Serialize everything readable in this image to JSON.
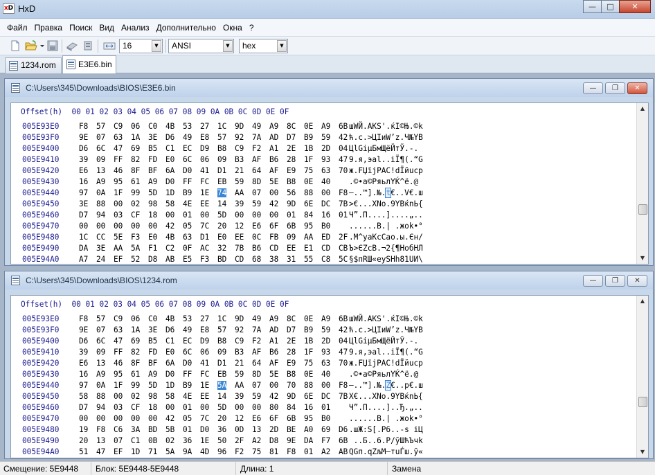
{
  "app": {
    "title": "HxD",
    "icon_label": "xD"
  },
  "menu": [
    "Файл",
    "Правка",
    "Поиск",
    "Вид",
    "Анализ",
    "Дополнительно",
    "Окна",
    "?"
  ],
  "toolbar": {
    "bytes_per_row": "16",
    "charset": "ANSI",
    "offset_base": "hex"
  },
  "tabs": [
    {
      "label": "1234.rom",
      "active": false
    },
    {
      "label": "E3E6.bin",
      "active": true
    }
  ],
  "header_row": "Offset(h)  00 01 02 03 04 05 06 07 08 09 0A 0B 0C 0D 0E 0F",
  "windows": [
    {
      "path": "C:\\Users\\345\\Downloads\\BIOS\\E3E6.bin",
      "selected_row": 6,
      "selected_col": 10,
      "rows": [
        {
          "offset": "005E93E0",
          "bytes": [
            "F8",
            "57",
            "C9",
            "06",
            "C0",
            "4B",
            "53",
            "27",
            "1C",
            "9D",
            "49",
            "A9",
            "8C",
            "0E",
            "A9",
            "6B"
          ],
          "text": "шWЙ.AKS'.ќI©Њ.©k"
        },
        {
          "offset": "005E93F0",
          "bytes": [
            "9E",
            "07",
            "63",
            "1A",
            "3E",
            "D6",
            "49",
            "E8",
            "57",
            "92",
            "7A",
            "AD",
            "D7",
            "B9",
            "59",
            "42"
          ],
          "text": "ћ.c.>ЦIиW’z.Ч№YB"
        },
        {
          "offset": "005E9400",
          "bytes": [
            "D6",
            "6C",
            "47",
            "69",
            "B5",
            "C1",
            "EC",
            "D9",
            "B8",
            "C9",
            "F2",
            "A1",
            "2E",
            "1B",
            "2D",
            "04"
          ],
          "text": "ЦlGiµБмЩёЙтЎ.-."
        },
        {
          "offset": "005E9410",
          "bytes": [
            "39",
            "09",
            "FF",
            "82",
            "FD",
            "E0",
            "6C",
            "06",
            "09",
            "B3",
            "AF",
            "B6",
            "28",
            "1F",
            "93",
            "47"
          ],
          "text": "9.я‚эаl..іЇ¶(.“G"
        },
        {
          "offset": "005E9420",
          "bytes": [
            "E6",
            "13",
            "46",
            "8F",
            "BF",
            "6A",
            "D0",
            "41",
            "D1",
            "21",
            "64",
            "AF",
            "E9",
            "75",
            "63",
            "70"
          ],
          "text": "ж.FЏїjРАС!dЇйucp"
        },
        {
          "offset": "005E9430",
          "bytes": [
            "16",
            "A9",
            "95",
            "61",
            "A9",
            "D0",
            "FF",
            "FC",
            "EB",
            "59",
            "8D",
            "5E",
            "B8",
            "0E",
            "40"
          ],
          "text": ".©•а©РяьлYЌ^ё.@"
        },
        {
          "offset": "005E9440",
          "bytes": [
            "97",
            "0A",
            "1F",
            "99",
            "5D",
            "1D",
            "B9",
            "1E",
            "74",
            "AA",
            "07",
            "00",
            "56",
            "88",
            "00",
            "F8"
          ],
          "text": "—..™].№.t€..V€.ш"
        },
        {
          "offset": "005E9450",
          "bytes": [
            "3E",
            "88",
            "00",
            "02",
            "98",
            "58",
            "4E",
            "EE",
            "14",
            "39",
            "59",
            "42",
            "9D",
            "6E",
            "DC",
            "7B"
          ],
          "text": ">€...XNo.9YBќnЬ{"
        },
        {
          "offset": "005E9460",
          "bytes": [
            "D7",
            "94",
            "03",
            "CF",
            "18",
            "00",
            "01",
            "00",
            "5D",
            "00",
            "00",
            "00",
            "01",
            "84",
            "16",
            "01"
          ],
          "text": "Ч”.П....]....„.."
        },
        {
          "offset": "005E9470",
          "bytes": [
            "00",
            "00",
            "00",
            "00",
            "00",
            "42",
            "05",
            "7C",
            "20",
            "12",
            "E6",
            "6F",
            "6B",
            "95",
            "B0"
          ],
          "text": "......B.| .жok•°"
        },
        {
          "offset": "005E9480",
          "bytes": [
            "1C",
            "CC",
            "5E",
            "F3",
            "E0",
            "4B",
            "63",
            "D1",
            "E0",
            "EE",
            "0C",
            "FB",
            "09",
            "AA",
            "ED",
            "2F"
          ],
          "text": ".М^уаKcСао.ы.Єн/"
        },
        {
          "offset": "005E9490",
          "bytes": [
            "DA",
            "3E",
            "AA",
            "5A",
            "F1",
            "C2",
            "0F",
            "AC",
            "32",
            "7B",
            "B6",
            "CD",
            "EE",
            "E1",
            "CD",
            "CB"
          ],
          "text": "Ъ>ЄZсВ.¬2{¶НобНЛ"
        },
        {
          "offset": "005E94A0",
          "bytes": [
            "A7",
            "24",
            "EF",
            "52",
            "D8",
            "AB",
            "E5",
            "F3",
            "BD",
            "CD",
            "68",
            "38",
            "31",
            "55",
            "C8",
            "5C"
          ],
          "text": "§$пRШ«еуЅНh81UИ\\"
        }
      ]
    },
    {
      "path": "C:\\Users\\345\\Downloads\\BIOS\\1234.rom",
      "selected_row": 6,
      "selected_col": 10,
      "rows": [
        {
          "offset": "005E93E0",
          "bytes": [
            "F8",
            "57",
            "C9",
            "06",
            "C0",
            "4B",
            "53",
            "27",
            "1C",
            "9D",
            "49",
            "A9",
            "8C",
            "0E",
            "A9",
            "6B"
          ],
          "text": "шWЙ.AKS'.ќI©Њ.©k"
        },
        {
          "offset": "005E93F0",
          "bytes": [
            "9E",
            "07",
            "63",
            "1A",
            "3E",
            "D6",
            "49",
            "E8",
            "57",
            "92",
            "7A",
            "AD",
            "D7",
            "B9",
            "59",
            "42"
          ],
          "text": "ћ.c.>ЦIиW’z.Ч№YB"
        },
        {
          "offset": "005E9400",
          "bytes": [
            "D6",
            "6C",
            "47",
            "69",
            "B5",
            "C1",
            "EC",
            "D9",
            "B8",
            "C9",
            "F2",
            "A1",
            "2E",
            "1B",
            "2D",
            "04"
          ],
          "text": "ЦlGiµБмЩёЙтЎ.-."
        },
        {
          "offset": "005E9410",
          "bytes": [
            "39",
            "09",
            "FF",
            "82",
            "FD",
            "E0",
            "6C",
            "06",
            "09",
            "B3",
            "AF",
            "B6",
            "28",
            "1F",
            "93",
            "47"
          ],
          "text": "9.я‚эаl..іЇ¶(.“G"
        },
        {
          "offset": "005E9420",
          "bytes": [
            "E6",
            "13",
            "46",
            "8F",
            "BF",
            "6A",
            "D0",
            "41",
            "D1",
            "21",
            "64",
            "AF",
            "E9",
            "75",
            "63",
            "70"
          ],
          "text": "ж.FЏїjРАС!dЇйucp"
        },
        {
          "offset": "005E9430",
          "bytes": [
            "16",
            "A9",
            "95",
            "61",
            "A9",
            "D0",
            "FF",
            "FC",
            "EB",
            "59",
            "8D",
            "5E",
            "B8",
            "0E",
            "40"
          ],
          "text": ".©•а©РяьлYЌ^ё.@"
        },
        {
          "offset": "005E9440",
          "bytes": [
            "97",
            "0A",
            "1F",
            "99",
            "5D",
            "1D",
            "B9",
            "1E",
            "5A",
            "AA",
            "07",
            "00",
            "70",
            "88",
            "00",
            "F8"
          ],
          "text": "—..™].№.Z€..р€.ш"
        },
        {
          "offset": "005E9450",
          "bytes": [
            "58",
            "88",
            "00",
            "02",
            "98",
            "58",
            "4E",
            "EE",
            "14",
            "39",
            "59",
            "42",
            "9D",
            "6E",
            "DC",
            "7B"
          ],
          "text": "X€...XNo.9YBќnЬ{"
        },
        {
          "offset": "005E9460",
          "bytes": [
            "D7",
            "94",
            "03",
            "CF",
            "18",
            "00",
            "01",
            "00",
            "5D",
            "00",
            "00",
            "80",
            "84",
            "16",
            "01"
          ],
          "text": "Ч”.П....]..Ђ.„.."
        },
        {
          "offset": "005E9470",
          "bytes": [
            "00",
            "00",
            "00",
            "00",
            "00",
            "42",
            "05",
            "7C",
            "20",
            "12",
            "E6",
            "6F",
            "6B",
            "95",
            "B0"
          ],
          "text": "......B.| .жok•°"
        },
        {
          "offset": "005E9480",
          "bytes": [
            "19",
            "F8",
            "C6",
            "3A",
            "BD",
            "5B",
            "01",
            "D0",
            "36",
            "0D",
            "13",
            "2D",
            "BE",
            "A0",
            "69",
            "D6"
          ],
          "text": ".шЖ:Ѕ[.Р6..-ѕ iЦ"
        },
        {
          "offset": "005E9490",
          "bytes": [
            "20",
            "13",
            "07",
            "C1",
            "0B",
            "02",
            "36",
            "1E",
            "50",
            "2F",
            "A2",
            "D8",
            "9E",
            "DA",
            "F7",
            "6B"
          ],
          "text": " ..Б..6.P/ўШћЪчk"
        },
        {
          "offset": "005E94A0",
          "bytes": [
            "51",
            "47",
            "EF",
            "1D",
            "71",
            "5A",
            "9A",
            "4D",
            "96",
            "F2",
            "75",
            "81",
            "F8",
            "01",
            "A2",
            "AB"
          ],
          "text": "QGп.qZљM–тuЃш.ў«"
        }
      ]
    }
  ],
  "status": {
    "offset": "Смещение: 5E9448",
    "block": "Блок: 5E9448-5E9448",
    "length": "Длина: 1",
    "mode": "Замена"
  },
  "colors": {
    "selection": "#3a86d6",
    "offset_text": "#1b1b8f"
  }
}
